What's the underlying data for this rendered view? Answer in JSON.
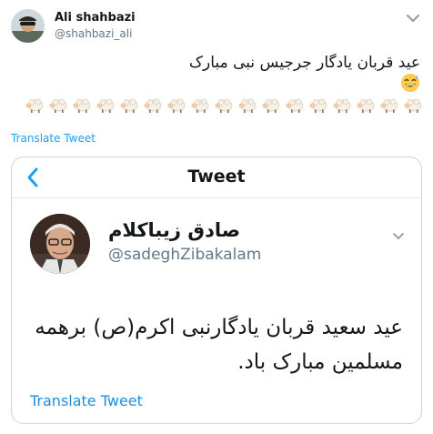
{
  "tweet": {
    "author_name": "Ali shahbazi",
    "author_handle": "@shahbazi_ali",
    "text": "عید قربان یادگار جرجیس نبی مبارک",
    "emoji_icon": "grinning-face-with-sweat-emoji",
    "sheep_icon": "sheep-emoji",
    "translate_label": "Translate Tweet"
  },
  "embedded_screenshot": {
    "header_title": "Tweet",
    "back_icon": "chevron-left-icon",
    "author_name": "صادق زیباکلام",
    "author_handle": "@sadeghZibakalam",
    "text": "عید سعید قربان یادگارنبی اکرم(ص) برهمه مسلمین مبارک باد.",
    "translate_label": "Translate Tweet"
  },
  "colors": {
    "accent": "#1da1f2",
    "secondary_text": "#657786",
    "border": "#ccd6dd"
  }
}
